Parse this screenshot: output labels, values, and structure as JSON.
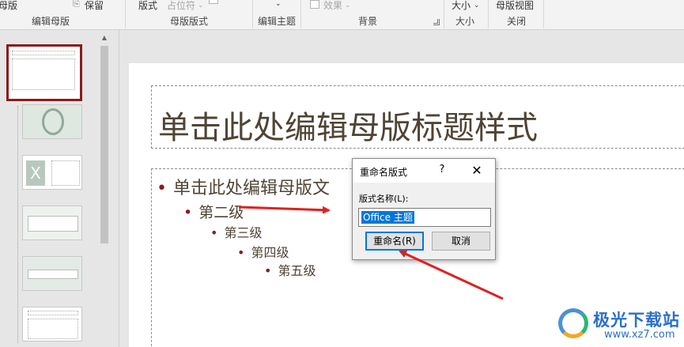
{
  "ribbon": {
    "items": {
      "master_partial": "母版",
      "preserve": "保留",
      "layout_partial": "版式",
      "placeholder": "占位符",
      "dropdown_arrow": "⌄",
      "effects": "效果",
      "size": "大小",
      "master_view": "母版视图"
    },
    "groups": {
      "edit_master": "编辑母版",
      "master_layout": "母版版式",
      "edit_theme": "编辑主题",
      "background": "背景",
      "size": "大小",
      "close": "关闭"
    }
  },
  "slide": {
    "title": "单击此处编辑母版标题样式",
    "levels": [
      "单击此处编辑母版文",
      "第二级",
      "第三级",
      "第四级",
      "第五级"
    ],
    "bullet": "•"
  },
  "dialog": {
    "title": "重命名版式",
    "help": "?",
    "close": "✕",
    "label": "版式名称(L):",
    "input_value": "Office 主题",
    "rename_button": "重命名(R)",
    "cancel_button": "取消"
  },
  "scrollbar": {
    "up_arrow": "▲"
  },
  "watermark": {
    "name": "极光下载站",
    "url": "www.xz7.com"
  },
  "colors": {
    "selection_border": "#8b1b1b",
    "title_text": "#4f4436",
    "bullet": "#8b1b1b",
    "arrow": "#e02020",
    "accent": "#0078d7"
  }
}
